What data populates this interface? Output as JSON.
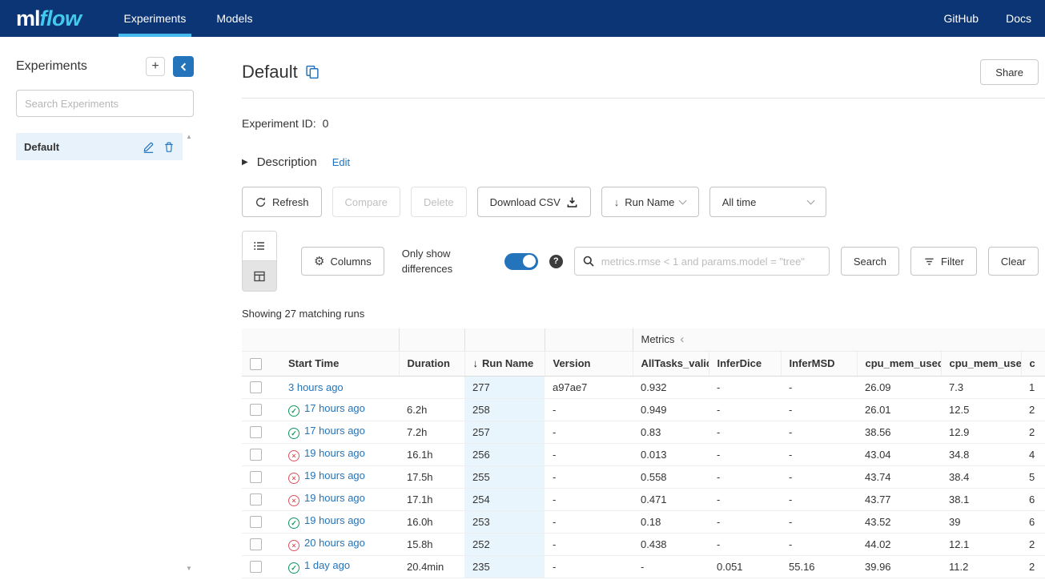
{
  "colors": {
    "navbar_bg": "#0b3574",
    "accent_blue": "#2374bb",
    "logo_flow_blue": "#43c9ed",
    "tab_underline": "#43b9ed",
    "sorted_column_bg": "#e9f5fd",
    "selected_item_bg": "#e7f2fb",
    "status_ok": "#10995c",
    "status_failed": "#e15361"
  },
  "navbar": {
    "logo_ml": "ml",
    "logo_flow": "flow",
    "tabs": [
      {
        "label": "Experiments"
      },
      {
        "label": "Models"
      }
    ],
    "links": [
      {
        "label": "GitHub"
      },
      {
        "label": "Docs"
      }
    ]
  },
  "sidebar": {
    "title": "Experiments",
    "add_button": "+",
    "search_placeholder": "Search Experiments",
    "items": [
      {
        "name": "Default"
      }
    ]
  },
  "main": {
    "title": "Default",
    "share_button": "Share",
    "experiment_id_label": "Experiment ID:",
    "experiment_id_value": "0",
    "description_label": "Description",
    "edit_link": "Edit",
    "toolbar": {
      "refresh": "Refresh",
      "compare": "Compare",
      "delete": "Delete",
      "download_csv": "Download CSV",
      "sort_label": "Run Name",
      "time_filter": "All time"
    },
    "controls": {
      "columns": "Columns",
      "only_show_differences": "Only show differences",
      "search_placeholder": "metrics.rmse < 1 and params.model = \"tree\"",
      "search_button": "Search",
      "filter_button": "Filter",
      "clear_button": "Clear"
    },
    "matching_runs": "Showing 27 matching runs",
    "table": {
      "group_header": "Metrics",
      "columns": [
        "Start Time",
        "Duration",
        "Run Name",
        "Version",
        "AllTasks_validDic",
        "InferDice",
        "InferMSD",
        "cpu_mem_used_",
        "cpu_mem_used_",
        "c"
      ],
      "rows": [
        {
          "status": "",
          "start_time": "3 hours ago",
          "duration": "",
          "run_name": "277",
          "version": "a97ae7",
          "metrics": [
            "0.932",
            "-",
            "-",
            "26.09",
            "7.3",
            "1"
          ]
        },
        {
          "status": "ok",
          "start_time": "17 hours ago",
          "duration": "6.2h",
          "run_name": "258",
          "version": "-",
          "metrics": [
            "0.949",
            "-",
            "-",
            "26.01",
            "12.5",
            "2"
          ]
        },
        {
          "status": "ok",
          "start_time": "17 hours ago",
          "duration": "7.2h",
          "run_name": "257",
          "version": "-",
          "metrics": [
            "0.83",
            "-",
            "-",
            "38.56",
            "12.9",
            "2"
          ]
        },
        {
          "status": "fail",
          "start_time": "19 hours ago",
          "duration": "16.1h",
          "run_name": "256",
          "version": "-",
          "metrics": [
            "0.013",
            "-",
            "-",
            "43.04",
            "34.8",
            "4"
          ]
        },
        {
          "status": "fail",
          "start_time": "19 hours ago",
          "duration": "17.5h",
          "run_name": "255",
          "version": "-",
          "metrics": [
            "0.558",
            "-",
            "-",
            "43.74",
            "38.4",
            "5"
          ]
        },
        {
          "status": "fail",
          "start_time": "19 hours ago",
          "duration": "17.1h",
          "run_name": "254",
          "version": "-",
          "metrics": [
            "0.471",
            "-",
            "-",
            "43.77",
            "38.1",
            "6"
          ]
        },
        {
          "status": "ok",
          "start_time": "19 hours ago",
          "duration": "16.0h",
          "run_name": "253",
          "version": "-",
          "metrics": [
            "0.18",
            "-",
            "-",
            "43.52",
            "39",
            "6"
          ]
        },
        {
          "status": "fail",
          "start_time": "20 hours ago",
          "duration": "15.8h",
          "run_name": "252",
          "version": "-",
          "metrics": [
            "0.438",
            "-",
            "-",
            "44.02",
            "12.1",
            "2"
          ]
        },
        {
          "status": "ok",
          "start_time": "1 day ago",
          "duration": "20.4min",
          "run_name": "235",
          "version": "-",
          "metrics": [
            "-",
            "0.051",
            "55.16",
            "39.96",
            "11.2",
            "2"
          ]
        }
      ]
    }
  }
}
